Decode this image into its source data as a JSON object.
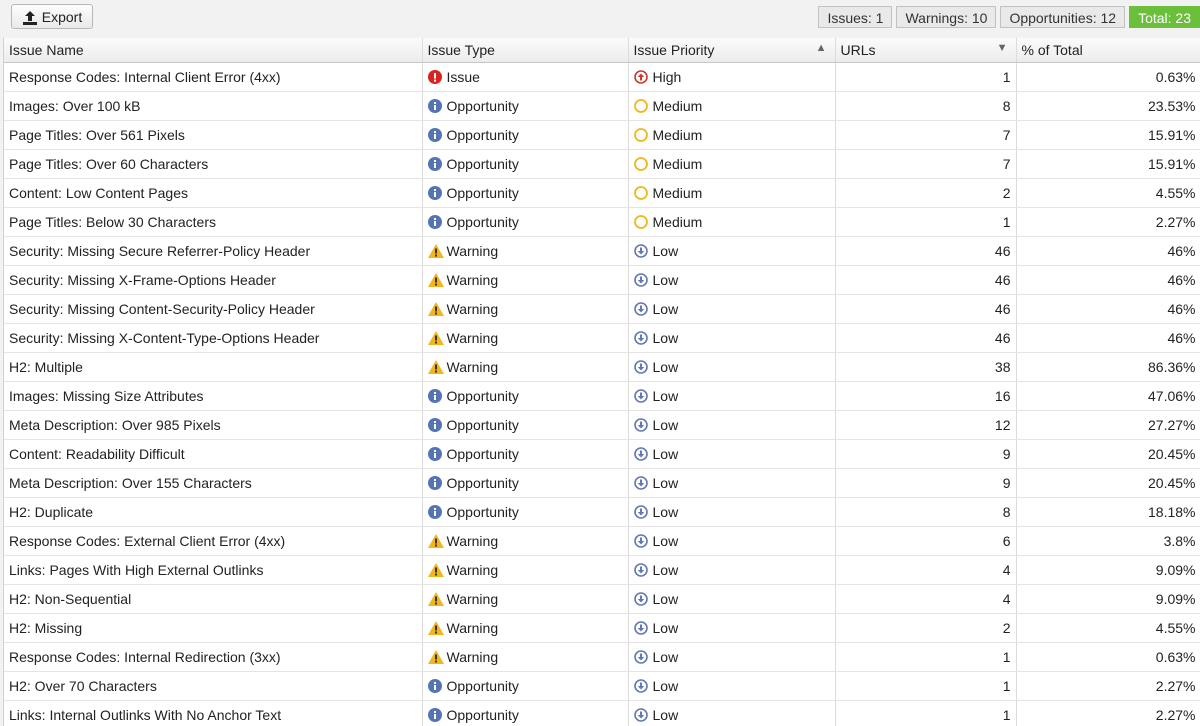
{
  "toolbar": {
    "export_label": "Export"
  },
  "counts": {
    "issues": "Issues: 1",
    "warnings": "Warnings: 10",
    "opportunities": "Opportunities: 12",
    "total": "Total: 23"
  },
  "columns": [
    "Issue Name",
    "Issue Type",
    "Issue Priority",
    "URLs",
    "% of Total"
  ],
  "rows": [
    {
      "name": "Response Codes: Internal Client Error (4xx)",
      "type": "Issue",
      "priority": "High",
      "urls": "1",
      "pct": "0.63%"
    },
    {
      "name": "Images: Over 100 kB",
      "type": "Opportunity",
      "priority": "Medium",
      "urls": "8",
      "pct": "23.53%"
    },
    {
      "name": "Page Titles: Over 561 Pixels",
      "type": "Opportunity",
      "priority": "Medium",
      "urls": "7",
      "pct": "15.91%"
    },
    {
      "name": "Page Titles: Over 60 Characters",
      "type": "Opportunity",
      "priority": "Medium",
      "urls": "7",
      "pct": "15.91%"
    },
    {
      "name": "Content: Low Content Pages",
      "type": "Opportunity",
      "priority": "Medium",
      "urls": "2",
      "pct": "4.55%"
    },
    {
      "name": "Page Titles: Below 30 Characters",
      "type": "Opportunity",
      "priority": "Medium",
      "urls": "1",
      "pct": "2.27%"
    },
    {
      "name": "Security: Missing Secure Referrer-Policy Header",
      "type": "Warning",
      "priority": "Low",
      "urls": "46",
      "pct": "46%"
    },
    {
      "name": "Security: Missing X-Frame-Options Header",
      "type": "Warning",
      "priority": "Low",
      "urls": "46",
      "pct": "46%"
    },
    {
      "name": "Security: Missing Content-Security-Policy Header",
      "type": "Warning",
      "priority": "Low",
      "urls": "46",
      "pct": "46%"
    },
    {
      "name": "Security: Missing X-Content-Type-Options Header",
      "type": "Warning",
      "priority": "Low",
      "urls": "46",
      "pct": "46%"
    },
    {
      "name": "H2: Multiple",
      "type": "Warning",
      "priority": "Low",
      "urls": "38",
      "pct": "86.36%"
    },
    {
      "name": "Images: Missing Size Attributes",
      "type": "Opportunity",
      "priority": "Low",
      "urls": "16",
      "pct": "47.06%"
    },
    {
      "name": "Meta Description: Over 985 Pixels",
      "type": "Opportunity",
      "priority": "Low",
      "urls": "12",
      "pct": "27.27%"
    },
    {
      "name": "Content: Readability Difficult",
      "type": "Opportunity",
      "priority": "Low",
      "urls": "9",
      "pct": "20.45%"
    },
    {
      "name": "Meta Description: Over 155 Characters",
      "type": "Opportunity",
      "priority": "Low",
      "urls": "9",
      "pct": "20.45%"
    },
    {
      "name": "H2: Duplicate",
      "type": "Opportunity",
      "priority": "Low",
      "urls": "8",
      "pct": "18.18%"
    },
    {
      "name": "Response Codes: External Client Error (4xx)",
      "type": "Warning",
      "priority": "Low",
      "urls": "6",
      "pct": "3.8%"
    },
    {
      "name": "Links: Pages With High External Outlinks",
      "type": "Warning",
      "priority": "Low",
      "urls": "4",
      "pct": "9.09%"
    },
    {
      "name": "H2: Non-Sequential",
      "type": "Warning",
      "priority": "Low",
      "urls": "4",
      "pct": "9.09%"
    },
    {
      "name": "H2: Missing",
      "type": "Warning",
      "priority": "Low",
      "urls": "2",
      "pct": "4.55%"
    },
    {
      "name": "Response Codes: Internal Redirection (3xx)",
      "type": "Warning",
      "priority": "Low",
      "urls": "1",
      "pct": "0.63%"
    },
    {
      "name": "H2: Over 70 Characters",
      "type": "Opportunity",
      "priority": "Low",
      "urls": "1",
      "pct": "2.27%"
    },
    {
      "name": "Links: Internal Outlinks With No Anchor Text",
      "type": "Opportunity",
      "priority": "Low",
      "urls": "1",
      "pct": "2.27%"
    }
  ],
  "icons": {
    "Issue": "issue-icon",
    "Opportunity": "info-icon",
    "Warning": "warning-icon",
    "High": "arrow-up-circle-icon",
    "Medium": "circle-icon",
    "Low": "arrow-down-circle-icon"
  },
  "colors": {
    "issue": "#d9231e",
    "opportunity": "#5574b3",
    "warning": "#f2b51c",
    "high": "#c73a30",
    "medium": "#f2b51c",
    "low": "#6277b5",
    "total_badge": "#6bbf3a"
  }
}
